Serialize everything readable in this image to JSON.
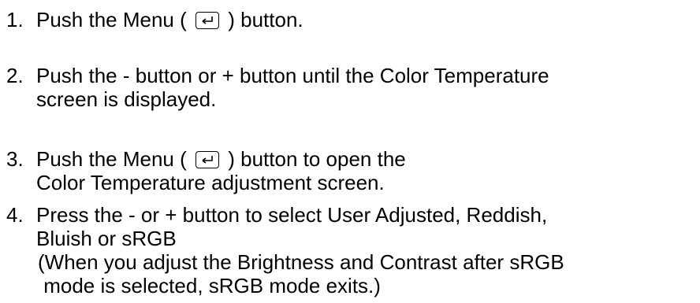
{
  "steps": [
    {
      "number": "1.",
      "before_icon": "Push the Menu (",
      "icon": "enter-key-icon",
      "after_icon": ") button."
    },
    {
      "number": "2.",
      "lines": [
        "Push the - button or + button until the Color Temperature",
        "screen is displayed."
      ]
    },
    {
      "number": "3.",
      "before_icon": "Push the Menu (",
      "icon": "enter-key-icon",
      "after_icon": ") button to open the",
      "line2": "Color Temperature adjustment screen."
    },
    {
      "number": "4.",
      "lines": [
        "Press the - or + button to select User Adjusted, Reddish,",
        "Bluish or sRGB"
      ],
      "note_lines": [
        "(When you adjust the Brightness and Contrast after sRGB",
        " mode is selected, sRGB mode exits.)"
      ]
    }
  ]
}
